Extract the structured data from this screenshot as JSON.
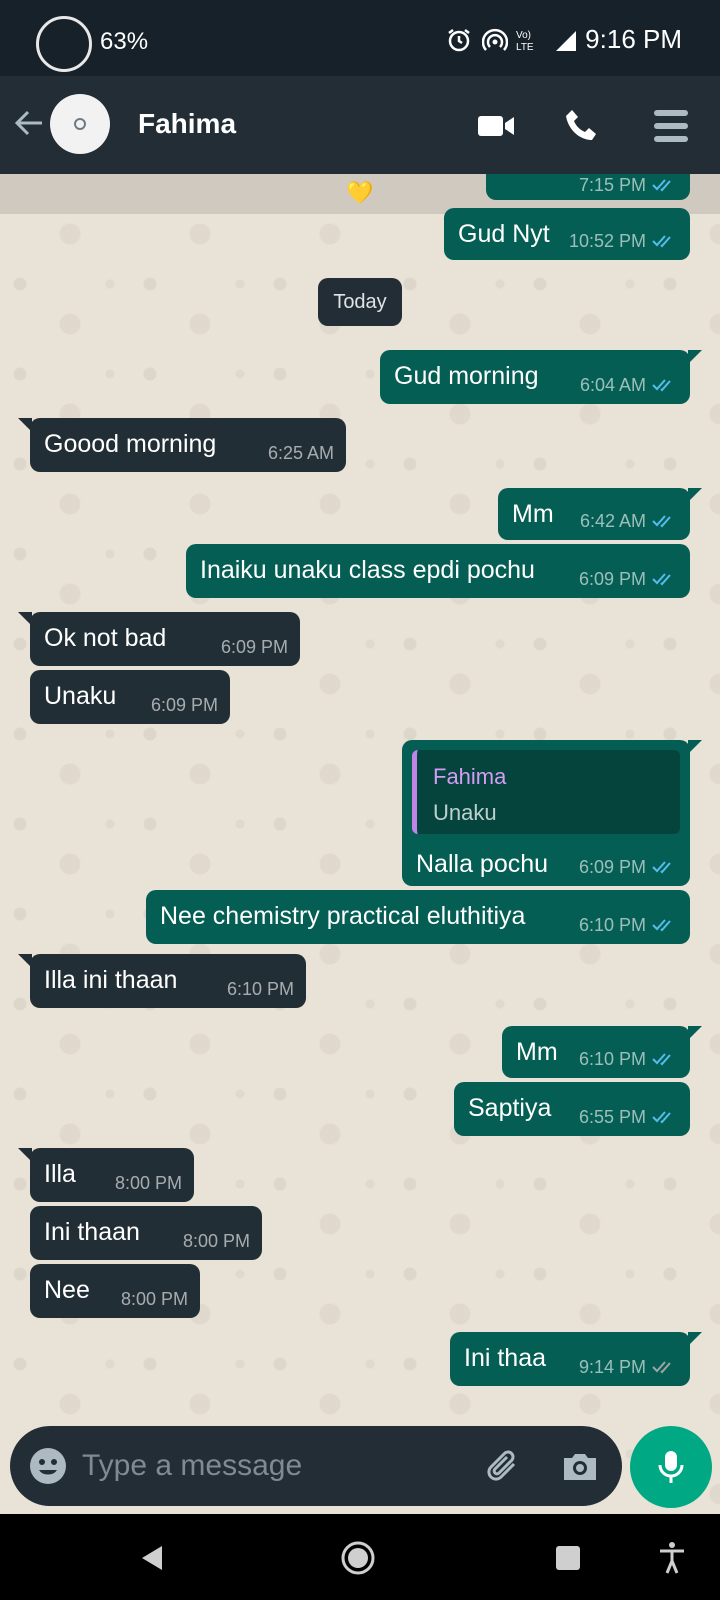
{
  "status_bar": {
    "battery": "63%",
    "time": "9:16 PM",
    "icons": [
      "alarm-icon",
      "hotspot-icon",
      "volte-icon",
      "lte-signal-icon"
    ]
  },
  "header": {
    "contact_name": "Fahima",
    "icons": [
      "back-arrow-icon",
      "video-call-icon",
      "phone-icon",
      "menu-icon"
    ]
  },
  "chat": {
    "partial_message_time": "7:15 PM",
    "date_divider": "Today",
    "messages": [
      {
        "dir": "out",
        "text": "Gud Nyt",
        "time": "10:52 PM",
        "status": "read"
      },
      {
        "dir": "out",
        "text": "Gud morning",
        "time": "6:04 AM",
        "status": "read"
      },
      {
        "dir": "in",
        "text": "Goood morning",
        "time": "6:25 AM"
      },
      {
        "dir": "out",
        "text": "Mm",
        "time": "6:42 AM",
        "status": "read"
      },
      {
        "dir": "out",
        "text": "Inaiku unaku class epdi pochu",
        "time": "6:09 PM",
        "status": "read"
      },
      {
        "dir": "in",
        "text": "Ok not bad",
        "time": "6:09 PM"
      },
      {
        "dir": "in",
        "text": "Unaku",
        "time": "6:09 PM"
      },
      {
        "dir": "out",
        "text": "Nalla pochu",
        "time": "6:09 PM",
        "status": "read",
        "quote": {
          "name": "Fahima",
          "text": "Unaku"
        }
      },
      {
        "dir": "out",
        "text": "Nee chemistry practical eluthitiya",
        "time": "6:10 PM",
        "status": "read"
      },
      {
        "dir": "in",
        "text": "Illa ini thaan",
        "time": "6:10 PM"
      },
      {
        "dir": "out",
        "text": "Mm",
        "time": "6:10 PM",
        "status": "read"
      },
      {
        "dir": "out",
        "text": "Saptiya",
        "time": "6:55 PM",
        "status": "read"
      },
      {
        "dir": "in",
        "text": "Illa",
        "time": "8:00 PM"
      },
      {
        "dir": "in",
        "text": "Ini thaan",
        "time": "8:00 PM"
      },
      {
        "dir": "in",
        "text": "Nee",
        "time": "8:00 PM"
      },
      {
        "dir": "out",
        "text": "Ini thaa",
        "time": "9:14 PM",
        "status": "delivered"
      }
    ]
  },
  "composer": {
    "placeholder": "Type a message",
    "icons": [
      "emoji-icon",
      "attach-icon",
      "camera-icon",
      "mic-icon"
    ]
  },
  "colors": {
    "outgoing": "#055e54",
    "incoming": "#222e35",
    "read_tick": "#53bdeb",
    "accent": "#00a884"
  }
}
